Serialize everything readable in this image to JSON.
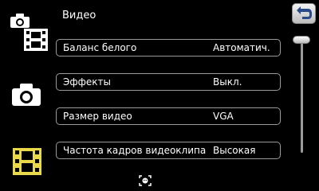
{
  "header": {
    "title": "Видео"
  },
  "settings": [
    {
      "label": "Баланс белого",
      "value": "Автоматич."
    },
    {
      "label": "Эффекты",
      "value": "Выкл."
    },
    {
      "label": "Размер видео",
      "value": "VGA"
    },
    {
      "label": "Частота кадров видеоклипа",
      "value": "Высокая"
    }
  ],
  "sidebar": {
    "modes": [
      "camera-icon",
      "video-icon"
    ]
  },
  "icons": {
    "back": "back-arrow-icon",
    "bottom": "face-detection-icon"
  },
  "colors": {
    "background": "#000000",
    "film_yellow": "#e8d84a",
    "film_gray": "#ffffff",
    "row_border": "#9a9a9a"
  }
}
